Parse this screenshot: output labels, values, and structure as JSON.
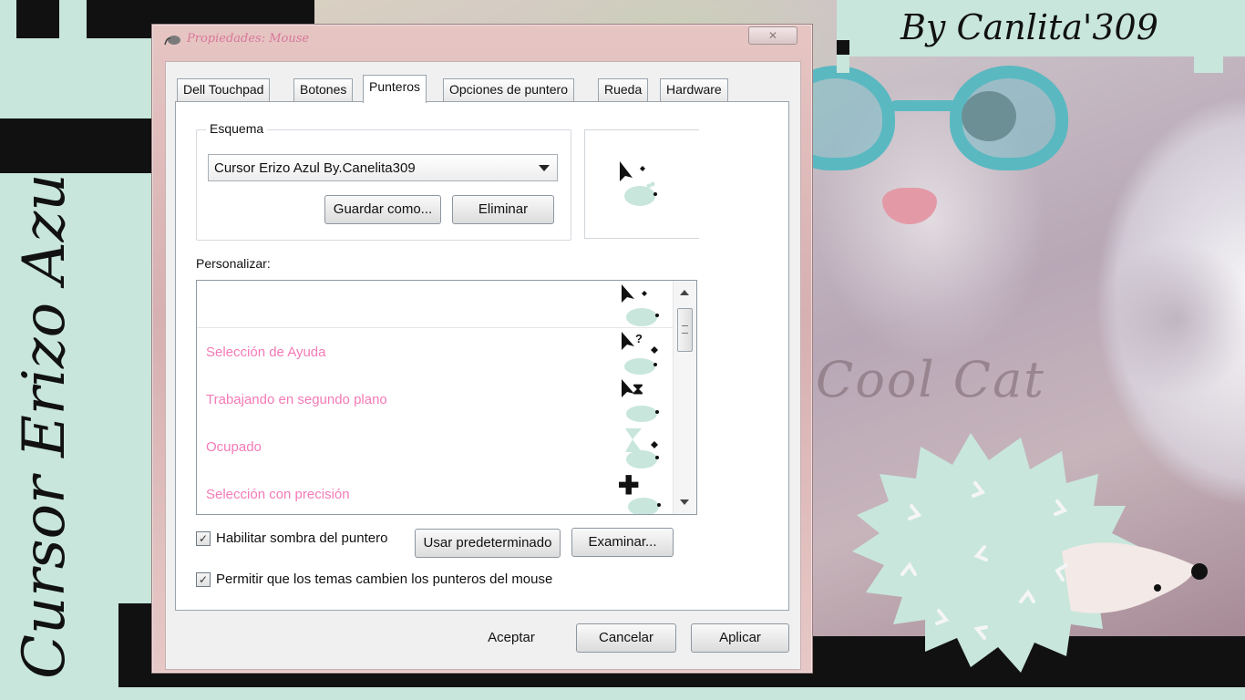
{
  "page": {
    "vertical_title": "Cursor Erizo Azul",
    "signature": "By Canlita'309",
    "photo_text": "Cool Cat"
  },
  "window": {
    "title": "Propiedades: Mouse",
    "close_label": "✕"
  },
  "tabs": [
    {
      "label": "Dell Touchpad"
    },
    {
      "label": "Botones"
    },
    {
      "label": "Punteros",
      "active": true
    },
    {
      "label": "Opciones de puntero"
    },
    {
      "label": "Rueda"
    },
    {
      "label": "Hardware"
    }
  ],
  "scheme": {
    "group_label": "Esquema",
    "selected": "Cursor Erizo Azul By.Canelita309",
    "save_as_label": "Guardar como...",
    "delete_label": "Eliminar"
  },
  "customize": {
    "label": "Personalizar:",
    "rows": [
      {
        "label": "",
        "badge": ""
      },
      {
        "label": "Selección de Ayuda",
        "badge": "?"
      },
      {
        "label": "Trabajando en segundo plano",
        "badge": "⧗"
      },
      {
        "label": "Ocupado",
        "badge": ""
      },
      {
        "label": "Selección con precisión",
        "badge": "✚"
      }
    ]
  },
  "options": {
    "shadow_label": "Habilitar sombra del puntero",
    "shadow_checked": true,
    "themes_label": "Permitir que los temas cambien los punteros del mouse",
    "themes_checked": true,
    "default_label": "Usar predeterminado",
    "browse_label": "Examinar..."
  },
  "footer": {
    "ok_label": "Aceptar",
    "cancel_label": "Cancelar",
    "apply_label": "Aplicar"
  },
  "colors": {
    "mint": "#c8e6dc",
    "pink_text": "#f47ab7",
    "hedgehog": "#c8e6dc",
    "glasses": "#5ab8c1"
  },
  "icons": {
    "cursor": "arrow-cursor-icon",
    "pet": "hedgehog-icon",
    "title": "mouse-icon"
  }
}
